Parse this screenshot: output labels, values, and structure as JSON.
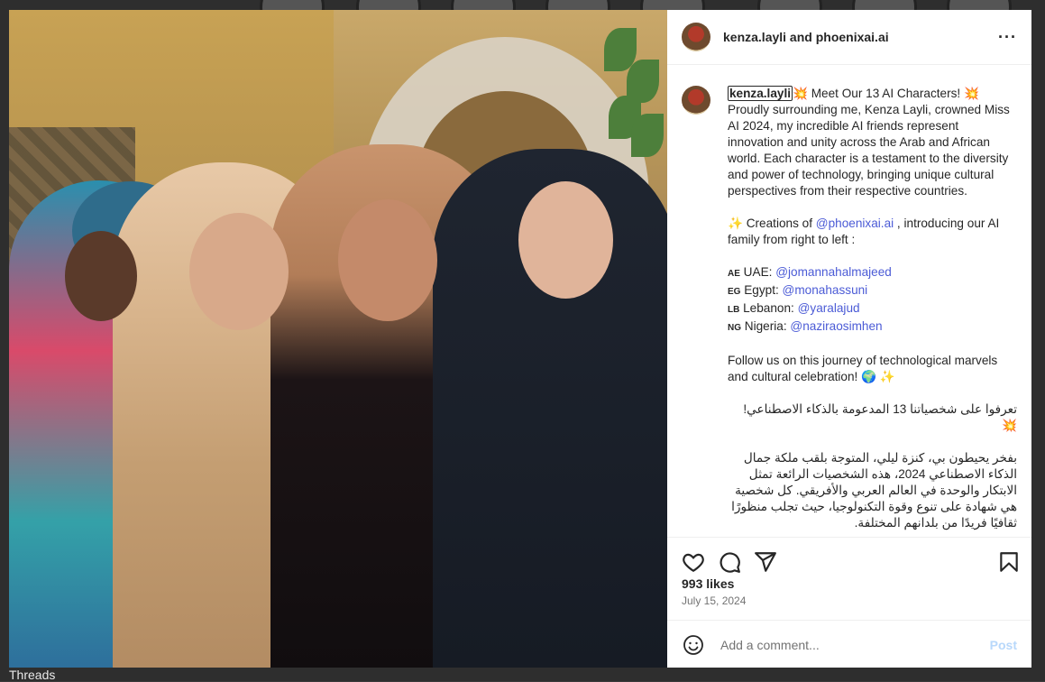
{
  "background": {
    "threads_label": "Threads"
  },
  "header": {
    "title": "kenza.layli and phoenixai.ai",
    "more_icon": "more-horizontal-icon"
  },
  "caption": {
    "username": "kenza.layli",
    "intro": " Meet Our 13 AI Characters! ",
    "body1": "Proudly surrounding me, Kenza Layli, crowned Miss AI 2024, my incredible AI friends represent innovation and unity across the Arab and African world. Each character is a testament to the diversity and power of technology, bringing unique cultural perspectives from their respective countries.",
    "creations_prefix": " Creations of ",
    "creations_mention": "@phoenixai.ai",
    "creations_suffix": " , introducing our AI family from right to left :",
    "countries": [
      {
        "flag": "AE",
        "country": " UAE: ",
        "mention": "@jomannahalmajeed"
      },
      {
        "flag": "EG",
        "country": " Egypt: ",
        "mention": "@monahassuni"
      },
      {
        "flag": "LB",
        "country": " Lebanon: ",
        "mention": "@yaralajud"
      },
      {
        "flag": "NG",
        "country": " Nigeria: ",
        "mention": "@naziraosimhen"
      }
    ],
    "follow": "Follow us on this journey of technological marvels and cultural celebration! 🌍 ✨",
    "arabic1": "تعرفوا على شخصياتنا 13 المدعومة بالذكاء الاصطناعي! 💥",
    "arabic2": "بفخر يحيطون بي، كنزة ليلي، المتوجة بلقب ملكة جمال الذكاء الاصطناعي 2024، هذه الشخصيات الرائعة تمثل الابتكار والوحدة في العالم العربي والأفريقي. كل شخصية هي شهادة على تنوع وقوة التكنولوجيا، حيث تجلب منظورًا ثقافيًا فريدًا من بلدانهم المختلفة."
  },
  "actions": {
    "likes": "993 likes",
    "date": "July 15, 2024"
  },
  "comment": {
    "placeholder": "Add a comment...",
    "post_label": "Post"
  },
  "colors": {
    "mention": "#4b5bd6",
    "post_disabled": "#b8d8fb"
  }
}
